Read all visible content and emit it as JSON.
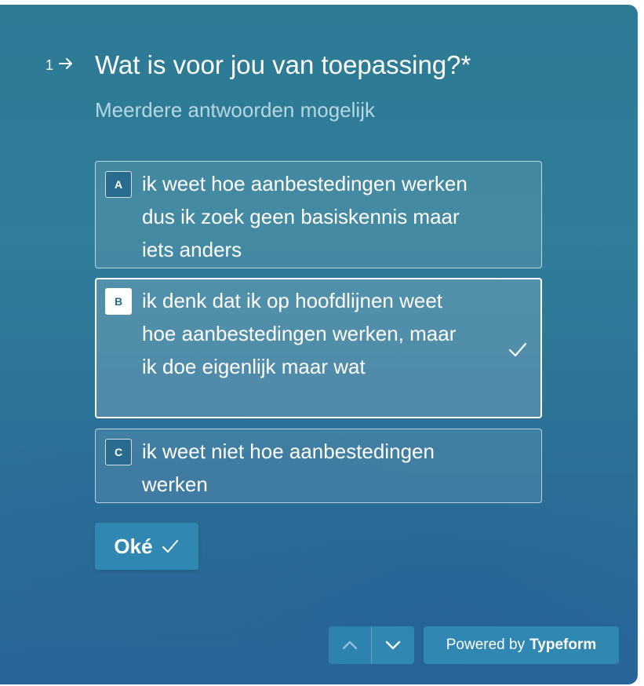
{
  "question": {
    "number": "1",
    "arrow_icon": "arrow-right-icon",
    "title": "Wat is voor jou van toepassing?*",
    "subtitle": "Meerdere antwoorden mogelijk"
  },
  "options": [
    {
      "key": "A",
      "text": "ik weet hoe aanbestedingen werken dus ik zoek geen basiskennis maar iets anders",
      "selected": false
    },
    {
      "key": "B",
      "text": "ik denk dat ik op hoofdlijnen weet hoe aanbestedingen werken, maar ik doe eigenlijk maar wat",
      "selected": true
    },
    {
      "key": "C",
      "text": "ik weet niet hoe aanbestedingen werken",
      "selected": false
    }
  ],
  "submit": {
    "label": "Oké",
    "icon": "checkmark-icon"
  },
  "navigation": {
    "up_icon": "chevron-up-icon",
    "down_icon": "chevron-down-icon"
  },
  "branding": {
    "prefix": "Powered by",
    "brand": "Typeform"
  },
  "colors": {
    "background": "#2d7a95",
    "button": "#2f87b2",
    "subtitle": "#b6d6e2",
    "text": "#ffffff"
  }
}
